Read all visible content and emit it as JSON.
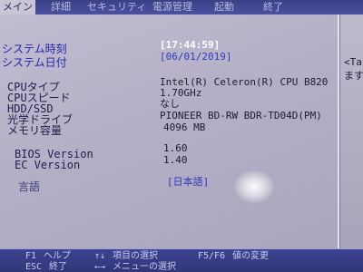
{
  "menu": {
    "items": [
      "メイン",
      "詳細",
      "セキュリティ",
      "電源管理",
      "起動",
      "終了"
    ]
  },
  "rows": [
    {
      "label": "システム時刻",
      "value": "[17:44:59]",
      "value_style": "sel"
    },
    {
      "label": "システム日付",
      "value": "[06/01/2019]",
      "value_style": "blue"
    },
    {
      "label": "CPUタイプ",
      "value": "Intel(R) Celeron(R) CPU B820"
    },
    {
      "label": "CPUスピード",
      "value": "1.70GHz"
    },
    {
      "label": "HDD/SSD",
      "value": "なし"
    },
    {
      "label": "光学ドライブ",
      "value": "PIONEER BD-RW  BDR-TD04D(PM)"
    },
    {
      "label": "メモリ容量",
      "value": "4096 MB"
    },
    {
      "label": "BIOS Version",
      "value": "1.60"
    },
    {
      "label": "EC Version",
      "value": "1.40"
    },
    {
      "label": "言語",
      "value": "[日本語]",
      "value_style": "blue"
    }
  ],
  "help": {
    "line1": "<Ta",
    "line2": "ます"
  },
  "footer": {
    "f1_key": "F1",
    "f1_label": "ヘルプ",
    "updown_key": "↑↓",
    "updown_label": "項目の選択",
    "f5f6_key": "F5/F6",
    "f5f6_label": "値の変更",
    "esc_key": "ESC",
    "esc_label": "終了",
    "lr_key": "←→",
    "lr_label": "メニューの選択"
  }
}
